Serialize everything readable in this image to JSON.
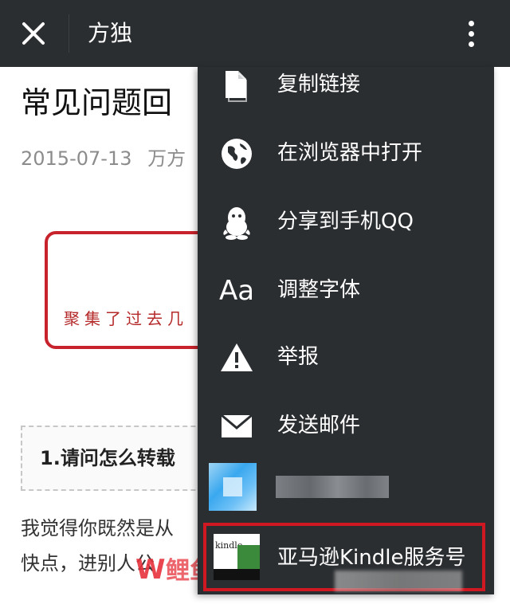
{
  "topbar": {
    "close_icon": "close-icon",
    "title": "方独",
    "more_icon": "more-vertical-icon",
    "background": "#2b2e31"
  },
  "article": {
    "title": "常见问题回",
    "date": "2015-07-13",
    "author": "万方",
    "boxed_text": "聚集了过去几",
    "question": "1.请问怎么转载",
    "para_line1": "我觉得你既然是从",
    "para_line2": "快点，进别人公",
    "watermark": "W鲤鱼"
  },
  "menu": {
    "items": [
      {
        "icon": "document-copy-icon",
        "label": "复制链接"
      },
      {
        "icon": "globe-icon",
        "label": "在浏览器中打开"
      },
      {
        "icon": "qq-penguin-icon",
        "label": "分享到手机QQ"
      },
      {
        "icon": "font-size-icon",
        "icon_text": "Aa",
        "label": "调整字体"
      },
      {
        "icon": "warning-icon",
        "label": "举报"
      },
      {
        "icon": "mail-icon",
        "label": "发送邮件"
      }
    ],
    "blurred_account": {
      "icon": "blurred-avatar"
    },
    "kindle": {
      "icon": "kindle-logo",
      "logo_text": "kindle",
      "label": "亚马逊Kindle服务号"
    },
    "highlight_color": "#d01822"
  }
}
